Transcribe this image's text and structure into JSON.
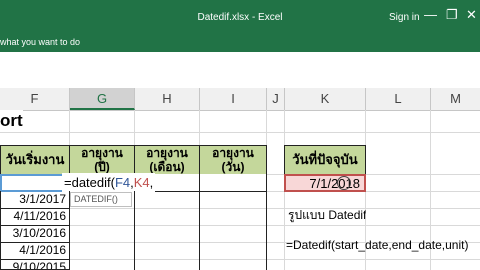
{
  "window": {
    "title": "Datedif.xlsx - Excel",
    "sign_in": "Sign in",
    "minimize": "—",
    "restore": "❐",
    "close": "✕"
  },
  "ribbon": {
    "tell_me": "what you want to do"
  },
  "columns": [
    "F",
    "G",
    "H",
    "I",
    "J",
    "K",
    "L",
    "M"
  ],
  "sheet": {
    "title_fragment": "ort",
    "headers": {
      "start_date": "วันเริ่มงาน",
      "age_years": [
        "อายุงาน",
        "(ปี)"
      ],
      "age_months": [
        "อายุงาน",
        "(เดือน)"
      ],
      "age_days": [
        "อายุงาน",
        "(วัน)"
      ],
      "today": "วันที่ปัจจุบัน"
    },
    "start_dates": [
      "3/1/2017",
      "4/11/2016",
      "3/10/2016",
      "4/1/2016",
      "9/10/2015"
    ],
    "editing_formula": {
      "prefix": "=datedif(",
      "ref1": "F4",
      "sep": ",",
      "ref2": "K4",
      "tail": ","
    },
    "formula_tooltip": "DATEDIF()",
    "today_value": "7/1/2018",
    "format_label": "รูปแบบ Datedif",
    "syntax": "=Datedif(start_date,end_date,unit)"
  },
  "colors": {
    "excel_green": "#217346",
    "header_green": "#c4d79b",
    "ref_blue": "#2f5597",
    "ref_red": "#c0504d",
    "today_fill": "#f8d7d7"
  }
}
